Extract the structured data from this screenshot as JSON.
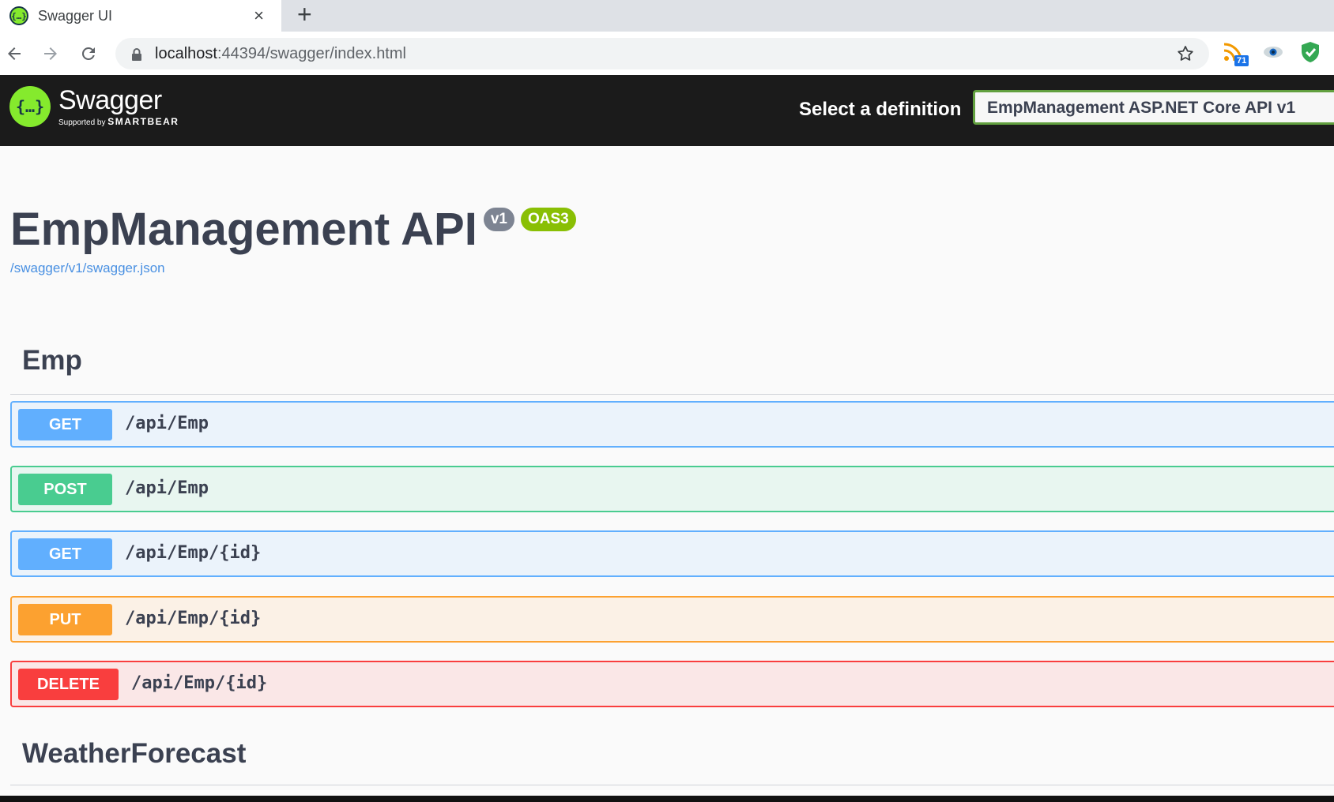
{
  "browser": {
    "tab_title": "Swagger UI",
    "tab_close": "×",
    "new_tab": "+",
    "favicon_glyph": "{…}",
    "url_host": "localhost",
    "url_rest": ":44394/swagger/index.html",
    "extension_badge": "71"
  },
  "topbar": {
    "logo_glyph": "{…}",
    "logo_name": "Swagger",
    "logo_supported_by": "Supported by",
    "logo_smartbear": "SMARTBEAR",
    "definition_label": "Select a definition",
    "definition_selected": "EmpManagement ASP.NET Core API v1"
  },
  "info": {
    "title": "EmpManagement API",
    "version_badge": "v1",
    "oas_badge": "OAS3",
    "spec_url": "/swagger/v1/swagger.json"
  },
  "sections": [
    {
      "name": "Emp",
      "operations": [
        {
          "method": "GET",
          "path": "/api/Emp"
        },
        {
          "method": "POST",
          "path": "/api/Emp"
        },
        {
          "method": "GET",
          "path": "/api/Emp/{id}"
        },
        {
          "method": "PUT",
          "path": "/api/Emp/{id}"
        },
        {
          "method": "DELETE",
          "path": "/api/Emp/{id}"
        }
      ]
    },
    {
      "name": "WeatherForecast",
      "operations": []
    }
  ],
  "colors": {
    "get": "#61affe",
    "post": "#49cc90",
    "put": "#fca130",
    "delete": "#f93e3e",
    "swagger_green": "#85ea2d",
    "topbar": "#1b1b1b"
  }
}
